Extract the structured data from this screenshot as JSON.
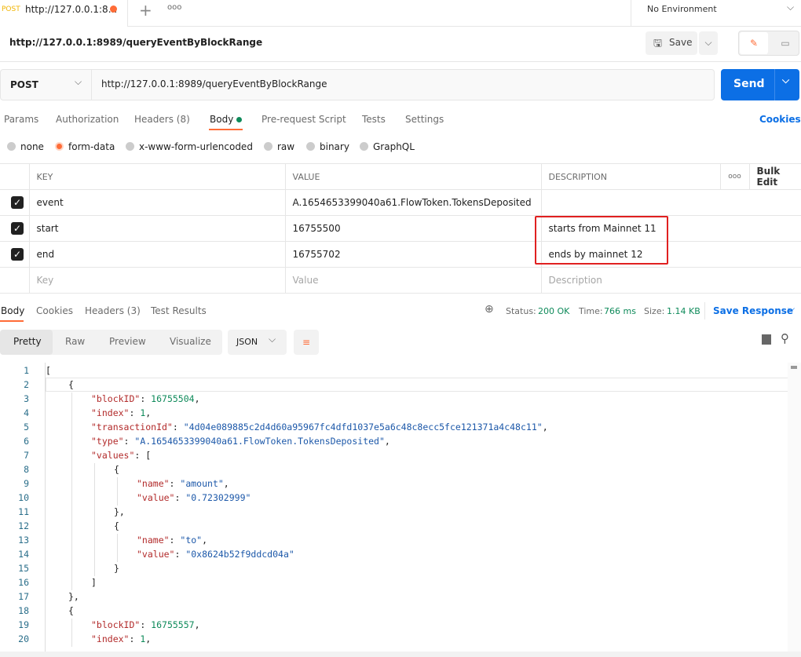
{
  "tab": {
    "method": "POST",
    "title": "http://127.0.0.1:8...",
    "environment": "No Environment"
  },
  "request": {
    "name": "http://127.0.0.1:8989/queryEventByBlockRange",
    "save": "Save",
    "method": "POST",
    "url": "http://127.0.0.1:8989/queryEventByBlockRange",
    "send": "Send"
  },
  "req_tabs": [
    "Params",
    "Authorization",
    "Headers (8)",
    "Body",
    "Pre-request Script",
    "Tests",
    "Settings"
  ],
  "cookies": "Cookies",
  "body_types": [
    "none",
    "form-data",
    "x-www-form-urlencoded",
    "raw",
    "binary",
    "GraphQL"
  ],
  "table": {
    "headers": [
      "KEY",
      "VALUE",
      "DESCRIPTION"
    ],
    "bulk_edit": "Bulk Edit",
    "rows": [
      {
        "key": "event",
        "value": "A.1654653399040a61.FlowToken.TokensDeposited",
        "description": ""
      },
      {
        "key": "start",
        "value": "16755500",
        "description": "starts from Mainnet 11"
      },
      {
        "key": "end",
        "value": "16755702",
        "description": "ends by mainnet 12"
      }
    ],
    "placeholders": {
      "key": "Key",
      "value": "Value",
      "description": "Description"
    }
  },
  "res_tabs": [
    "Body",
    "Cookies",
    "Headers (3)",
    "Test Results"
  ],
  "status": {
    "status_label": "Status:",
    "status": "200 OK",
    "time_label": "Time:",
    "time": "766 ms",
    "size_label": "Size:",
    "size": "1.14 KB",
    "save_response": "Save Response"
  },
  "view_modes": [
    "Pretty",
    "Raw",
    "Preview",
    "Visualize"
  ],
  "format": "JSON",
  "colors": {
    "accent": "#0c6fe5",
    "orange": "#ff6c37",
    "green": "#0e8a5a",
    "highlight_box": "#e02020"
  },
  "code_lines": [
    [
      0,
      [
        [
          "p",
          "["
        ]
      ]
    ],
    [
      1,
      [
        [
          "p",
          "{"
        ]
      ]
    ],
    [
      2,
      [
        [
          "k",
          "\"blockID\""
        ],
        [
          "p",
          ": "
        ],
        [
          "n",
          "16755504"
        ],
        [
          "p",
          ","
        ]
      ]
    ],
    [
      2,
      [
        [
          "k",
          "\"index\""
        ],
        [
          "p",
          ": "
        ],
        [
          "n",
          "1"
        ],
        [
          "p",
          ","
        ]
      ]
    ],
    [
      2,
      [
        [
          "k",
          "\"transactionId\""
        ],
        [
          "p",
          ": "
        ],
        [
          "s",
          "\"4d04e089885c2d4d60a95967fc4dfd1037e5a6c48c8ecc5fce121371a4c48c11\""
        ],
        [
          "p",
          ","
        ]
      ]
    ],
    [
      2,
      [
        [
          "k",
          "\"type\""
        ],
        [
          "p",
          ": "
        ],
        [
          "s",
          "\"A.1654653399040a61.FlowToken.TokensDeposited\""
        ],
        [
          "p",
          ","
        ]
      ]
    ],
    [
      2,
      [
        [
          "k",
          "\"values\""
        ],
        [
          "p",
          ": ["
        ]
      ]
    ],
    [
      3,
      [
        [
          "p",
          "{"
        ]
      ]
    ],
    [
      4,
      [
        [
          "k",
          "\"name\""
        ],
        [
          "p",
          ": "
        ],
        [
          "s",
          "\"amount\""
        ],
        [
          "p",
          ","
        ]
      ]
    ],
    [
      4,
      [
        [
          "k",
          "\"value\""
        ],
        [
          "p",
          ": "
        ],
        [
          "s",
          "\"0.72302999\""
        ]
      ]
    ],
    [
      3,
      [
        [
          "p",
          "},"
        ]
      ]
    ],
    [
      3,
      [
        [
          "p",
          "{"
        ]
      ]
    ],
    [
      4,
      [
        [
          "k",
          "\"name\""
        ],
        [
          "p",
          ": "
        ],
        [
          "s",
          "\"to\""
        ],
        [
          "p",
          ","
        ]
      ]
    ],
    [
      4,
      [
        [
          "k",
          "\"value\""
        ],
        [
          "p",
          ": "
        ],
        [
          "s",
          "\"0x8624b52f9ddcd04a\""
        ]
      ]
    ],
    [
      3,
      [
        [
          "p",
          "}"
        ]
      ]
    ],
    [
      2,
      [
        [
          "p",
          "]"
        ]
      ]
    ],
    [
      1,
      [
        [
          "p",
          "},"
        ]
      ]
    ],
    [
      1,
      [
        [
          "p",
          "{"
        ]
      ]
    ],
    [
      2,
      [
        [
          "k",
          "\"blockID\""
        ],
        [
          "p",
          ": "
        ],
        [
          "n",
          "16755557"
        ],
        [
          "p",
          ","
        ]
      ]
    ],
    [
      2,
      [
        [
          "k",
          "\"index\""
        ],
        [
          "p",
          ": "
        ],
        [
          "n",
          "1"
        ],
        [
          "p",
          ","
        ]
      ]
    ]
  ]
}
